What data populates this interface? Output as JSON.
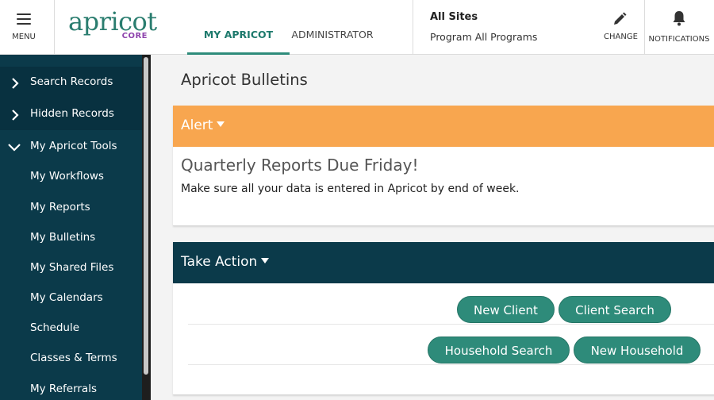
{
  "header": {
    "menu_label": "MENU",
    "logo_main": "apricot",
    "logo_sub": "CORE",
    "tabs": [
      {
        "label": "MY APRICOT",
        "active": true
      },
      {
        "label": "ADMINISTRATOR",
        "active": false
      }
    ],
    "site_title": "All Sites",
    "site_program": "Program All Programs",
    "change_label": "CHANGE",
    "notifications_label": "NOTIFICATIONS"
  },
  "sidebar": {
    "sections": [
      {
        "label": "Search Records",
        "icon": "chevron-right-icon",
        "expanded": false
      },
      {
        "label": "Hidden Records",
        "icon": "chevron-right-icon",
        "expanded": false
      },
      {
        "label": "My Apricot Tools",
        "icon": "chevron-down-icon",
        "expanded": true
      }
    ],
    "items": [
      {
        "label": "My Workflows"
      },
      {
        "label": "My Reports"
      },
      {
        "label": "My Bulletins"
      },
      {
        "label": "My Shared Files"
      },
      {
        "label": "My Calendars"
      },
      {
        "label": "Schedule"
      },
      {
        "label": "Classes & Terms"
      },
      {
        "label": "My Referrals"
      }
    ]
  },
  "main": {
    "page_title": "Apricot Bulletins",
    "alert": {
      "header": "Alert",
      "title": "Quarterly Reports Due Friday!",
      "body": "Make sure all your data is entered in Apricot by end of week."
    },
    "take_action": {
      "header": "Take Action",
      "buttons": [
        {
          "label": "New Client"
        },
        {
          "label": "Client Search"
        },
        {
          "label": "Household Search"
        },
        {
          "label": "New Household"
        }
      ]
    }
  },
  "colors": {
    "alert": "#f8a64f",
    "dark_teal": "#0b3a4a",
    "button_green": "#2e8b7a",
    "accent_text": "#1e7a6d",
    "logo_sub": "#8e44ad"
  }
}
